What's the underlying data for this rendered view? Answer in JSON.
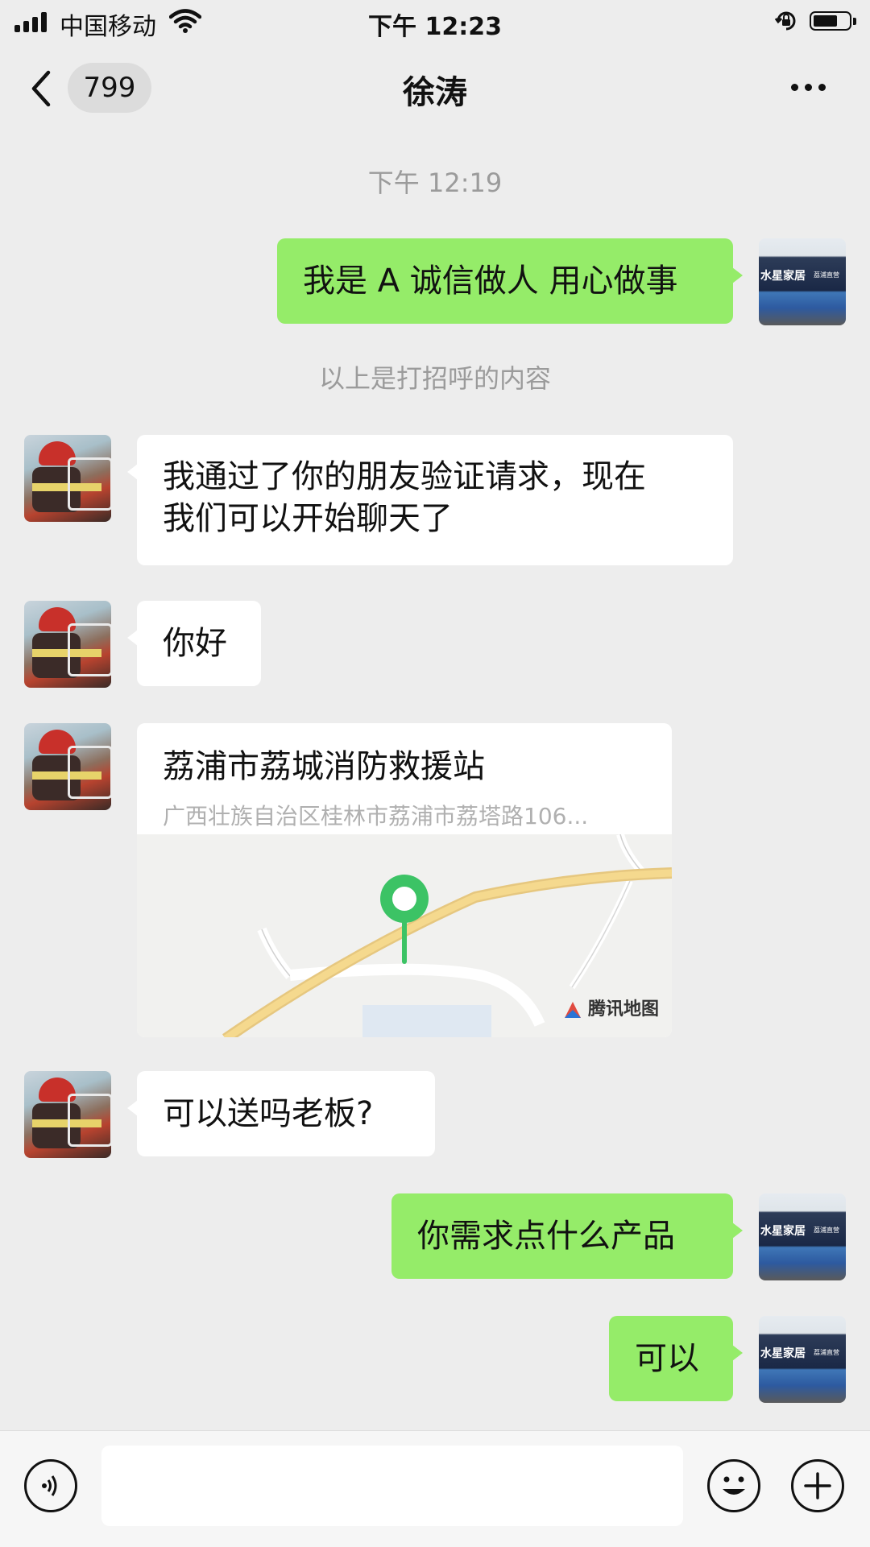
{
  "status_bar": {
    "carrier": "中国移动",
    "time": "下午 12:23",
    "battery_level": 0.6
  },
  "nav": {
    "unread_count": "799",
    "title": "徐涛"
  },
  "timestamp": "下午 12:19",
  "messages": [
    {
      "from": "me",
      "text": "我是 A 诚信做人 用心做事"
    },
    {
      "system": "以上是打招呼的内容"
    },
    {
      "from": "them",
      "line1": "我通过了你的朋友验证请求，现在",
      "line2": "我们可以开始聊天了"
    },
    {
      "from": "them",
      "text": "你好"
    },
    {
      "from": "them",
      "type": "location",
      "title": "荔浦市荔城消防救援站",
      "address": "广西壮族自治区桂林市荔浦市荔塔路106...",
      "map_brand": "腾讯地图"
    },
    {
      "from": "them",
      "text": "可以送吗老板?"
    },
    {
      "from": "me",
      "text": "你需求点什么产品"
    },
    {
      "from": "me",
      "text": "可以"
    }
  ],
  "avatars": {
    "me_sign": "水星家居",
    "me_sign_sub": "荔浦直营"
  },
  "colors": {
    "background": "#ededed",
    "my_bubble": "#95ec69",
    "their_bubble": "#ffffff"
  },
  "icons": [
    "voice-icon",
    "emoji-icon",
    "plus-icon",
    "back-chevron-icon",
    "more-icon",
    "map-pin-icon"
  ]
}
